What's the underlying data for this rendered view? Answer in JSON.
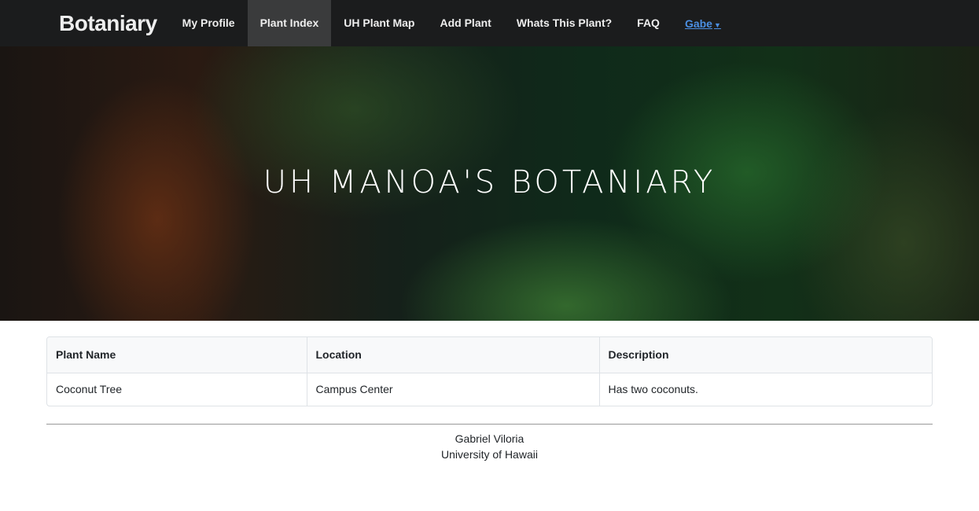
{
  "nav": {
    "brand": "Botaniary",
    "items": [
      {
        "label": "My Profile"
      },
      {
        "label": "Plant Index",
        "active": true
      },
      {
        "label": "UH Plant Map"
      },
      {
        "label": "Add Plant"
      },
      {
        "label": "Whats This Plant?"
      },
      {
        "label": "FAQ"
      }
    ],
    "user": "Gabe",
    "user_icon": "caret-down-icon"
  },
  "hero": {
    "title": "UH MANOA'S BOTANIARY"
  },
  "table": {
    "headers": [
      "Plant Name",
      "Location",
      "Description"
    ],
    "rows": [
      [
        "Coconut Tree",
        "Campus Center",
        "Has two coconuts."
      ]
    ]
  },
  "footer": {
    "line1": "Gabriel Viloria",
    "line2": "University of Hawaii"
  }
}
